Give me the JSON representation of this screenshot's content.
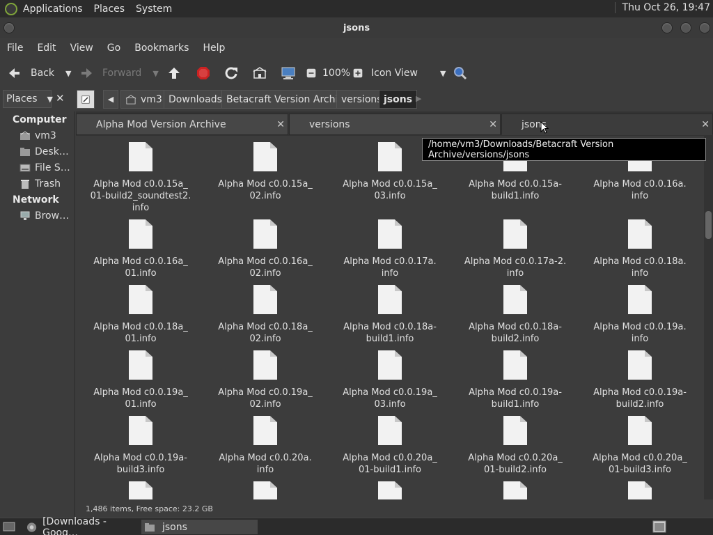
{
  "top_panel": {
    "menus": [
      "Applications",
      "Places",
      "System"
    ],
    "clock": "Thu Oct 26, 19:47"
  },
  "window": {
    "title": "jsons"
  },
  "menubar": [
    "File",
    "Edit",
    "View",
    "Go",
    "Bookmarks",
    "Help"
  ],
  "toolbar": {
    "back": "Back",
    "forward": "Forward",
    "zoom": "100%",
    "view_mode": "Icon View"
  },
  "location": {
    "places_label": "Places",
    "breadcrumbs": [
      "vm3",
      "Downloads",
      "Betacraft Version Archive",
      "versions",
      "jsons"
    ]
  },
  "sidebar": {
    "computer_header": "Computer",
    "computer_items": [
      "vm3",
      "Desk…",
      "File S…",
      "Trash"
    ],
    "network_header": "Network",
    "network_items": [
      "Brow…"
    ]
  },
  "tabs": [
    "Alpha Mod Version Archive",
    "versions",
    "jsons"
  ],
  "tooltip": "/home/vm3/Downloads/Betacraft Version Archive/versions/jsons",
  "files": [
    [
      "Alpha Mod c0.0.15a_",
      "01-build2_soundtest2.",
      "info"
    ],
    [
      "Alpha Mod c0.0.15a_",
      "02.info"
    ],
    [
      "Alpha Mod c0.0.15a_",
      "03.info"
    ],
    [
      "Alpha Mod c0.0.15a-",
      "build1.info"
    ],
    [
      "Alpha Mod c0.0.16a.",
      "info"
    ],
    [
      "Alpha Mod c0.0.16a_",
      "01.info"
    ],
    [
      "Alpha Mod c0.0.16a_",
      "02.info"
    ],
    [
      "Alpha Mod c0.0.17a.",
      "info"
    ],
    [
      "Alpha Mod c0.0.17a-2.",
      "info"
    ],
    [
      "Alpha Mod c0.0.18a.",
      "info"
    ],
    [
      "Alpha Mod c0.0.18a_",
      "01.info"
    ],
    [
      "Alpha Mod c0.0.18a_",
      "02.info"
    ],
    [
      "Alpha Mod c0.0.18a-",
      "build1.info"
    ],
    [
      "Alpha Mod c0.0.18a-",
      "build2.info"
    ],
    [
      "Alpha Mod c0.0.19a.",
      "info"
    ],
    [
      "Alpha Mod c0.0.19a_",
      "01.info"
    ],
    [
      "Alpha Mod c0.0.19a_",
      "02.info"
    ],
    [
      "Alpha Mod c0.0.19a_",
      "03.info"
    ],
    [
      "Alpha Mod c0.0.19a-",
      "build1.info"
    ],
    [
      "Alpha Mod c0.0.19a-",
      "build2.info"
    ],
    [
      "Alpha Mod c0.0.19a-",
      "build3.info"
    ],
    [
      "Alpha Mod c0.0.20a.",
      "info"
    ],
    [
      "Alpha Mod c0.0.20a_",
      "01-build1.info"
    ],
    [
      "Alpha Mod c0.0.20a_",
      "01-build2.info"
    ],
    [
      "Alpha Mod c0.0.20a_",
      "01-build3.info"
    ],
    [],
    [],
    [],
    [],
    []
  ],
  "status": "1,486 items, Free space: 23.2 GB",
  "taskbar": [
    "[Downloads - Goog…",
    "jsons"
  ]
}
